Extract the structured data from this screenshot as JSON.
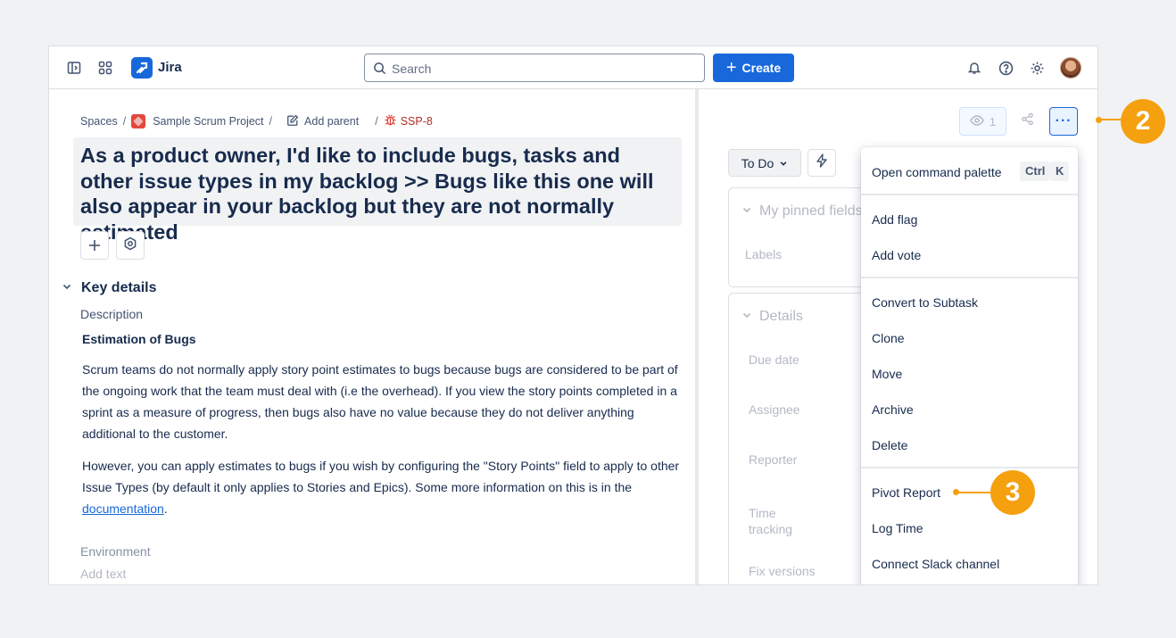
{
  "topbar": {
    "app_name": "Jira",
    "search_placeholder": "Search",
    "create_label": "Create"
  },
  "breadcrumb": {
    "spaces": "Spaces",
    "project": "Sample Scrum Project",
    "add_parent": "Add parent",
    "issue_key": "SSP-8"
  },
  "issue": {
    "title": "As a product owner, I'd like to include bugs, tasks and other issue types in my backlog >> Bugs like this one will also appear in your backlog but they are not normally estimated"
  },
  "key_details": {
    "heading": "Key details",
    "description_label": "Description",
    "estimation_heading": "Estimation of Bugs",
    "para1": "Scrum teams do not normally apply story point estimates to bugs because bugs are considered to be part of the ongoing work that the team must deal with (i.e the overhead). If you view the story points completed in a sprint as a measure of progress, then bugs also have no value because they do not deliver anything additional to the customer.",
    "para2_before": "However, you can apply estimates to bugs if you wish by configuring the \"Story Points\" field to apply to other Issue Types (by default it only applies to Stories and Epics). Some more information on this is in the ",
    "para2_link": "documentation",
    "para2_after": ".",
    "environment_label": "Environment",
    "environment_placeholder": "Add text"
  },
  "side": {
    "watch_count": "1",
    "more_label": "···",
    "status": "To Do",
    "pinned_heading": "My pinned fields",
    "labels_field": "Labels",
    "details_heading": "Details",
    "fields": [
      "Due date",
      "Assignee",
      "Reporter",
      "Time tracking",
      "Fix versions"
    ]
  },
  "menu": {
    "command_palette": "Open command palette",
    "kbd_ctrl": "Ctrl",
    "kbd_k": "K",
    "add_flag": "Add flag",
    "add_vote": "Add vote",
    "convert": "Convert to Subtask",
    "clone": "Clone",
    "move": "Move",
    "archive": "Archive",
    "delete": "Delete",
    "pivot": "Pivot Report",
    "log_time": "Log Time",
    "slack": "Connect Slack channel"
  },
  "annotations": {
    "step2": "2",
    "step3": "3"
  },
  "colors": {
    "brand_blue": "#1868db",
    "callout_orange": "#f5a00f",
    "bug_red": "#ae2e24"
  }
}
